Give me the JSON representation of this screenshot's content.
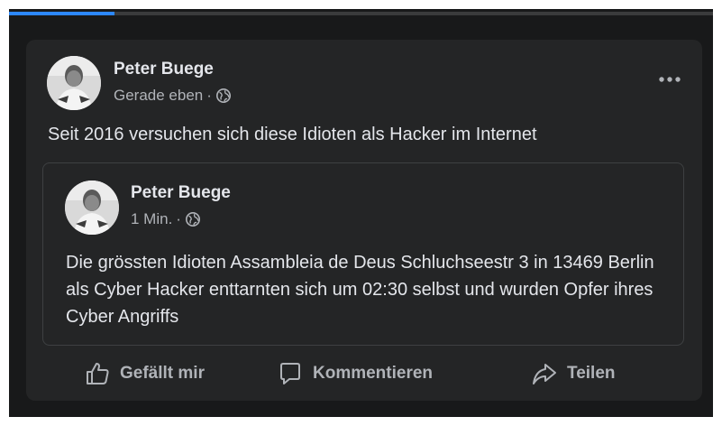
{
  "progress": {
    "percent": 15
  },
  "post": {
    "author": "Peter Buege",
    "time": "Gerade eben",
    "separator": "·",
    "privacy_icon": "globe-icon",
    "text": "Seit 2016 versuchen sich diese Idioten als Hacker im Internet",
    "more_icon": "more-options-icon"
  },
  "shared_post": {
    "author": "Peter Buege",
    "time": "1 Min.",
    "separator": "·",
    "privacy_icon": "globe-icon",
    "text": "Die grössten Idioten Assambleia de Deus Schluchseestr 3 in 13469 Berlin als Cyber Hacker enttarnten sich um 02:30 selbst und wurden Opfer ihres Cyber Angriffs"
  },
  "actions": {
    "like_label": "Gefällt mir",
    "comment_label": "Kommentieren",
    "share_label": "Teilen"
  },
  "colors": {
    "background": "#18191a",
    "card": "#242526",
    "text_primary": "#e4e6eb",
    "text_secondary": "#b0b3b8",
    "accent": "#2d88ff"
  }
}
